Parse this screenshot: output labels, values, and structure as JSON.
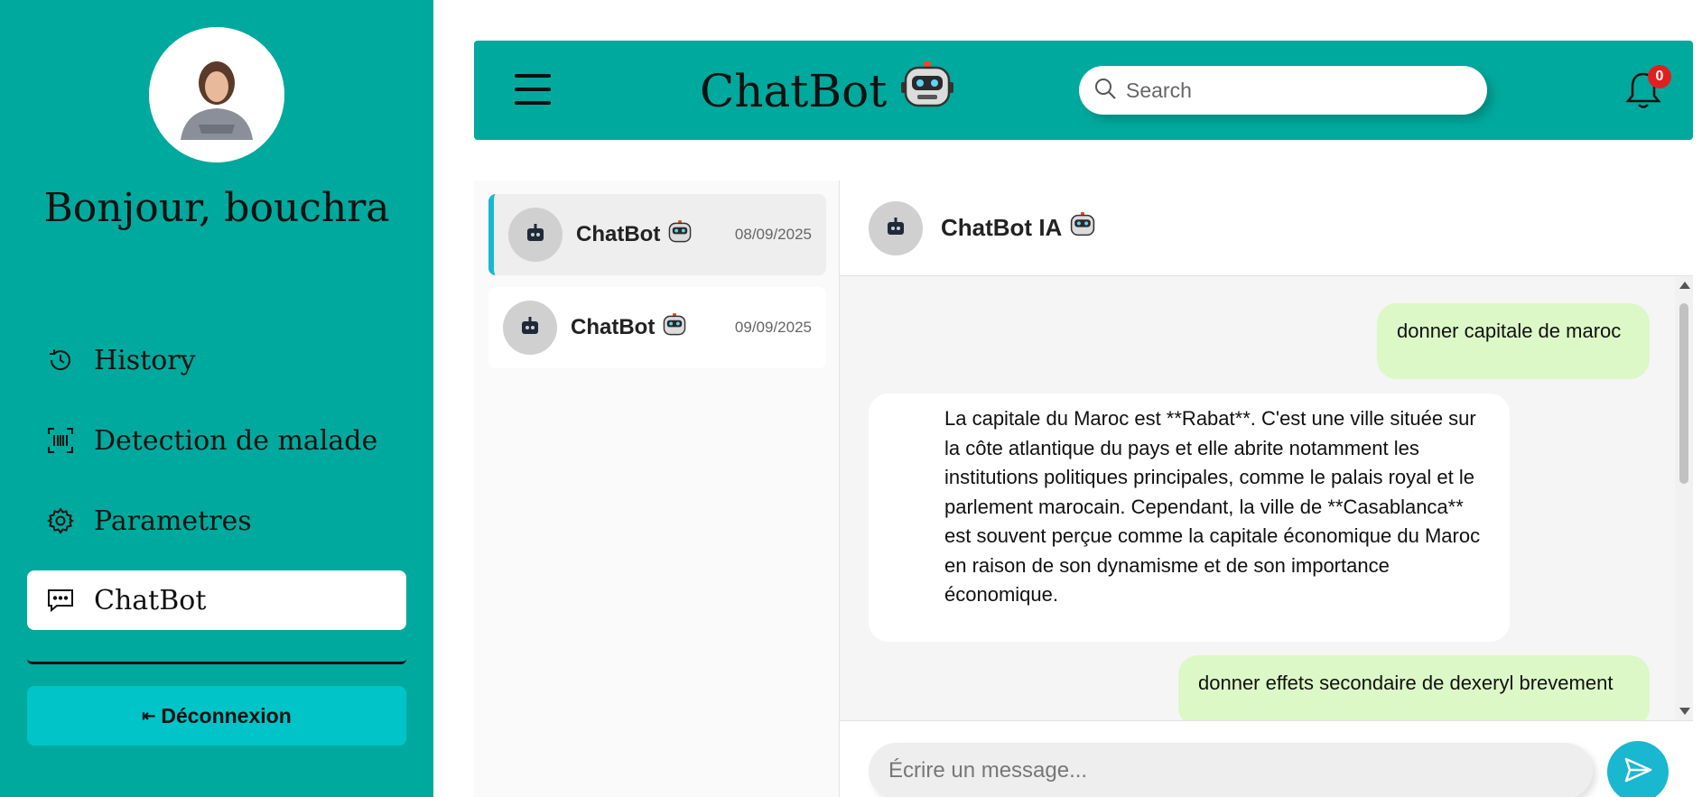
{
  "sidebar": {
    "greeting": "Bonjour, bouchra",
    "items": [
      {
        "label": "History",
        "icon": "clock-icon"
      },
      {
        "label": "Detection de malade",
        "icon": "barcode-scan-icon"
      },
      {
        "label": "Parametres",
        "icon": "gear-icon"
      },
      {
        "label": "ChatBot",
        "icon": "chat-bubble-icon",
        "active": true
      }
    ],
    "logout_label": "Déconnexion",
    "logout_icon": "⇤"
  },
  "header": {
    "brand": "ChatBot",
    "search_placeholder": "Search",
    "notification_count": "0"
  },
  "conversations": [
    {
      "name": "ChatBot",
      "date": "08/09/2025",
      "selected": true
    },
    {
      "name": "ChatBot",
      "date": "09/09/2025",
      "selected": false
    }
  ],
  "chat": {
    "title": "ChatBot IA",
    "messages": [
      {
        "role": "user",
        "text": "donner capitale de maroc"
      },
      {
        "role": "bot",
        "text": "La capitale du Maroc est **Rabat**. C'est une ville située sur la côte atlantique du pays et elle abrite notamment les institutions politiques principales, comme le palais royal et le parlement marocain. Cependant, la ville de **Casablanca** est souvent perçue comme la capitale économique du Maroc en raison de son dynamisme et de son importance économique."
      },
      {
        "role": "user",
        "text": "donner effets secondaire de dexeryl brevement"
      }
    ],
    "input_placeholder": "Écrire un message..."
  },
  "colors": {
    "primary": "#00a99d",
    "accent": "#1ab7d0",
    "logout": "#00c4c8",
    "user_bubble": "#dcf8c6",
    "badge": "#e02020"
  }
}
